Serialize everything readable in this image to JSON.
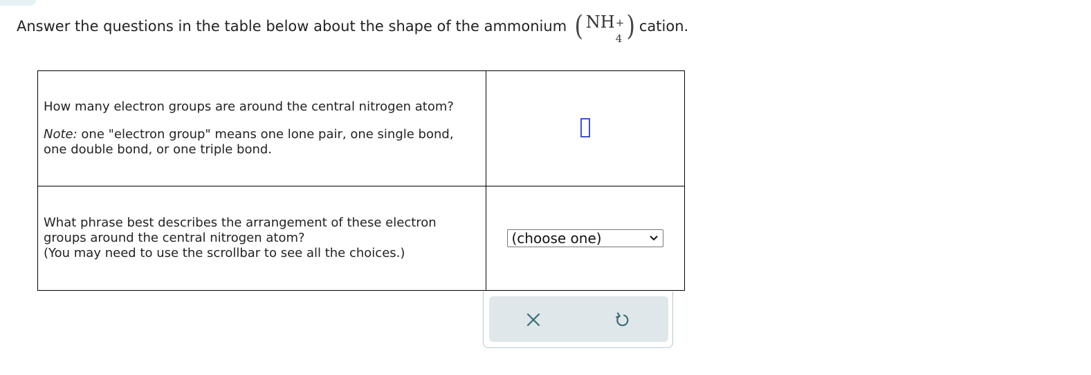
{
  "prompt": {
    "text_before": "Answer the questions in the table below about the shape of the ammonium",
    "formula": {
      "open_paren": "(",
      "base": "NH",
      "superscript": "+",
      "subscript": "4",
      "close_paren": ")"
    },
    "text_after": "cation."
  },
  "table": {
    "row1": {
      "question": "How many electron groups are around the central nitrogen atom?",
      "note_label": "Note:",
      "note_text": " one \"electron group\" means one lone pair, one single bond, one double bond, or one triple bond.",
      "answer_value": ""
    },
    "row2": {
      "question_line1": "What phrase best describes the arrangement of these electron groups around the central nitrogen atom?",
      "question_line2": "(You may need to use the scrollbar to see all the choices.)",
      "select_value": "(choose one)"
    }
  },
  "toolbar": {
    "clear_icon": "close-icon",
    "undo_icon": "undo-icon"
  },
  "colors": {
    "input_border": "#3f51d1",
    "toolbar_bg": "#dfe7ea",
    "icon_color": "#3c6a78"
  }
}
